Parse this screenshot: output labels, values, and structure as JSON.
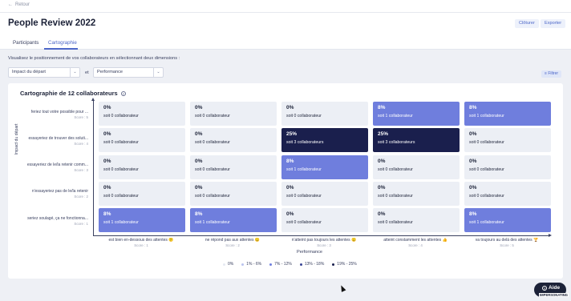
{
  "nav": {
    "back_label": "Retour"
  },
  "header": {
    "title": "People Review 2022",
    "close_label": "Clôturer",
    "export_label": "Exporter"
  },
  "tabs": [
    {
      "label": "Participants",
      "active": false
    },
    {
      "label": "Cartographie",
      "active": true
    }
  ],
  "instruction": "Visualisez le positionnement de vos collaborateurs en sélectionnant deux dimensions :",
  "filters": {
    "dimension_y": "Impact du départ",
    "conjunction": "et",
    "dimension_x": "Performance",
    "filter_label": "Filtrer"
  },
  "map": {
    "title": "Cartographie de 12 collaborateurs",
    "y_axis_label": "Impact du départ",
    "x_axis_label": "Performance",
    "rows": [
      {
        "label": "feriez tout votre possible pour ...",
        "score": "Score : 5"
      },
      {
        "label": "essayeriez de trouver des soluti...",
        "score": "Score : 4"
      },
      {
        "label": "essayeriez de le/la retenir comm...",
        "score": "Score : 3"
      },
      {
        "label": "n'essayeriez pas de le/la retenir",
        "score": "Score : 2"
      },
      {
        "label": "seriez soulagé, ça ne fonctionna...",
        "score": "Score : 1"
      }
    ],
    "columns": [
      {
        "label": "est bien en-dessous des attentes 😕",
        "score": "Score : 1"
      },
      {
        "label": "ne répond pas aux attentes 😐",
        "score": "Score : 2"
      },
      {
        "label": "n'atteint pas toujours les attentes 😐",
        "score": "Score : 3"
      },
      {
        "label": "atteint constamment les attentes 👍",
        "score": "Score : 4"
      },
      {
        "label": "va toujours au delà des attentes 🏆",
        "score": "Score : 5"
      }
    ],
    "cells": [
      [
        {
          "pct": "0%",
          "count": "soit 0 collaborateur",
          "level": 0
        },
        {
          "pct": "0%",
          "count": "soit 0 collaborateur",
          "level": 0
        },
        {
          "pct": "0%",
          "count": "soit 0 collaborateur",
          "level": 0
        },
        {
          "pct": "8%",
          "count": "soit 1 collaborateur",
          "level": 1
        },
        {
          "pct": "8%",
          "count": "soit 1 collaborateur",
          "level": 1
        }
      ],
      [
        {
          "pct": "0%",
          "count": "soit 0 collaborateur",
          "level": 0
        },
        {
          "pct": "0%",
          "count": "soit 0 collaborateur",
          "level": 0
        },
        {
          "pct": "25%",
          "count": "soit 3 collaborateurs",
          "level": 3
        },
        {
          "pct": "25%",
          "count": "soit 3 collaborateurs",
          "level": 3
        },
        {
          "pct": "0%",
          "count": "soit 0 collaborateur",
          "level": 0
        }
      ],
      [
        {
          "pct": "0%",
          "count": "soit 0 collaborateur",
          "level": 0
        },
        {
          "pct": "0%",
          "count": "soit 0 collaborateur",
          "level": 0
        },
        {
          "pct": "8%",
          "count": "soit 1 collaborateur",
          "level": 1
        },
        {
          "pct": "0%",
          "count": "soit 0 collaborateur",
          "level": 0
        },
        {
          "pct": "0%",
          "count": "soit 0 collaborateur",
          "level": 0
        }
      ],
      [
        {
          "pct": "0%",
          "count": "soit 0 collaborateur",
          "level": 0
        },
        {
          "pct": "0%",
          "count": "soit 0 collaborateur",
          "level": 0
        },
        {
          "pct": "0%",
          "count": "soit 0 collaborateur",
          "level": 0
        },
        {
          "pct": "0%",
          "count": "soit 0 collaborateur",
          "level": 0
        },
        {
          "pct": "0%",
          "count": "soit 0 collaborateur",
          "level": 0
        }
      ],
      [
        {
          "pct": "8%",
          "count": "soit 1 collaborateur",
          "level": 1
        },
        {
          "pct": "8%",
          "count": "soit 1 collaborateur",
          "level": 1
        },
        {
          "pct": "0%",
          "count": "soit 0 collaborateur",
          "level": 0
        },
        {
          "pct": "0%",
          "count": "soit 0 collaborateur",
          "level": 0
        },
        {
          "pct": "8%",
          "count": "soit 1 collaborateur",
          "level": 1
        }
      ]
    ],
    "legend": [
      {
        "label": "0%",
        "color": "#e6e9f2"
      },
      {
        "label": "1% - 6%",
        "color": "#b9c3ee"
      },
      {
        "label": "7% - 12%",
        "color": "#6f7edd"
      },
      {
        "label": "13% - 18%",
        "color": "#3a4595"
      },
      {
        "label": "19% - 25%",
        "color": "#1a1f4d"
      }
    ]
  },
  "help": {
    "label": "Aide",
    "impersonating": "IMPERSONATING"
  },
  "colors": {
    "accent": "#4d67c8",
    "dark": "#1a1f4d",
    "mid": "#6f7edd",
    "empty": "#eceff5"
  }
}
